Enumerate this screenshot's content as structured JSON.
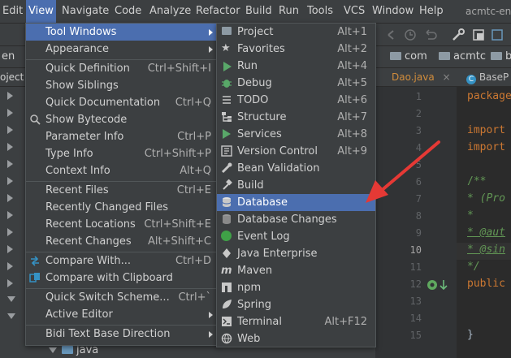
{
  "menubar": {
    "items": [
      "Edit",
      "View",
      "Navigate",
      "Code",
      "Analyze",
      "Refactor",
      "Build",
      "Run",
      "Tools",
      "VCS",
      "Window",
      "Help"
    ],
    "app_title": "acmtc-en"
  },
  "breadcrumbs": [
    "en",
    "com",
    "acmtc",
    "b"
  ],
  "tabs": {
    "file1": "Dao.java",
    "file2": "BaseP"
  },
  "project_label": "oject",
  "tree_bottom": "java",
  "view_menu": [
    {
      "label": "Tool Windows",
      "shortcut": "",
      "submenu": true
    },
    {
      "label": "Appearance",
      "shortcut": "",
      "submenu": true
    },
    {
      "label": "Quick Definition",
      "shortcut": "Ctrl+Shift+I"
    },
    {
      "label": "Show Siblings",
      "shortcut": ""
    },
    {
      "label": "Quick Documentation",
      "shortcut": "Ctrl+Q"
    },
    {
      "label": "Show Bytecode",
      "shortcut": ""
    },
    {
      "label": "Parameter Info",
      "shortcut": "Ctrl+P"
    },
    {
      "label": "Type Info",
      "shortcut": "Ctrl+Shift+P"
    },
    {
      "label": "Context Info",
      "shortcut": "Alt+Q"
    },
    {
      "label": "Recent Files",
      "shortcut": "Ctrl+E"
    },
    {
      "label": "Recently Changed Files",
      "shortcut": ""
    },
    {
      "label": "Recent Locations",
      "shortcut": "Ctrl+Shift+E"
    },
    {
      "label": "Recent Changes",
      "shortcut": "Alt+Shift+C"
    },
    {
      "label": "Compare With...",
      "shortcut": "Ctrl+D"
    },
    {
      "label": "Compare with Clipboard",
      "shortcut": ""
    },
    {
      "label": "Quick Switch Scheme...",
      "shortcut": "Ctrl+`"
    },
    {
      "label": "Active Editor",
      "shortcut": "",
      "submenu": true
    },
    {
      "label": "Bidi Text Base Direction",
      "shortcut": "",
      "submenu": true
    }
  ],
  "tool_windows_menu": [
    {
      "label": "Project",
      "shortcut": "Alt+1",
      "icon": "folder-icon"
    },
    {
      "label": "Favorites",
      "shortcut": "Alt+2",
      "icon": "star-icon"
    },
    {
      "label": "Run",
      "shortcut": "Alt+4",
      "icon": "run-icon"
    },
    {
      "label": "Debug",
      "shortcut": "Alt+5",
      "icon": "bug-icon"
    },
    {
      "label": "TODO",
      "shortcut": "Alt+6",
      "icon": "list-icon"
    },
    {
      "label": "Structure",
      "shortcut": "Alt+7",
      "icon": "structure-icon"
    },
    {
      "label": "Services",
      "shortcut": "Alt+8",
      "icon": "services-icon"
    },
    {
      "label": "Version Control",
      "shortcut": "Alt+9",
      "icon": "vcs-icon"
    },
    {
      "label": "Bean Validation",
      "shortcut": "",
      "icon": "bean-icon"
    },
    {
      "label": "Build",
      "shortcut": "",
      "icon": "hammer-icon"
    },
    {
      "label": "Database",
      "shortcut": "",
      "icon": "database-icon"
    },
    {
      "label": "Database Changes",
      "shortcut": "",
      "icon": "database-changes-icon"
    },
    {
      "label": "Event Log",
      "shortcut": "",
      "icon": "event-log-icon"
    },
    {
      "label": "Java Enterprise",
      "shortcut": "",
      "icon": "java-enterprise-icon"
    },
    {
      "label": "Maven",
      "shortcut": "",
      "icon": "maven-icon"
    },
    {
      "label": "npm",
      "shortcut": "",
      "icon": "npm-icon"
    },
    {
      "label": "Spring",
      "shortcut": "",
      "icon": "spring-icon"
    },
    {
      "label": "Terminal",
      "shortcut": "Alt+F12",
      "icon": "terminal-icon"
    },
    {
      "label": "Web",
      "shortcut": "",
      "icon": "web-icon"
    }
  ],
  "editor": {
    "line_numbers": [
      "1",
      "2",
      "3",
      "4",
      "5",
      "6",
      "7",
      "8",
      "9",
      "10",
      "11",
      "12",
      "13",
      "14",
      "15"
    ],
    "lines": [
      "package",
      "",
      "import",
      "import",
      "",
      "/**",
      " * (Pro",
      " *",
      " * @aut",
      " * @sin",
      " */",
      "public",
      "",
      "",
      "}"
    ]
  },
  "colors": {
    "accent": "#4b6eaf",
    "arrow": "#e53935"
  }
}
